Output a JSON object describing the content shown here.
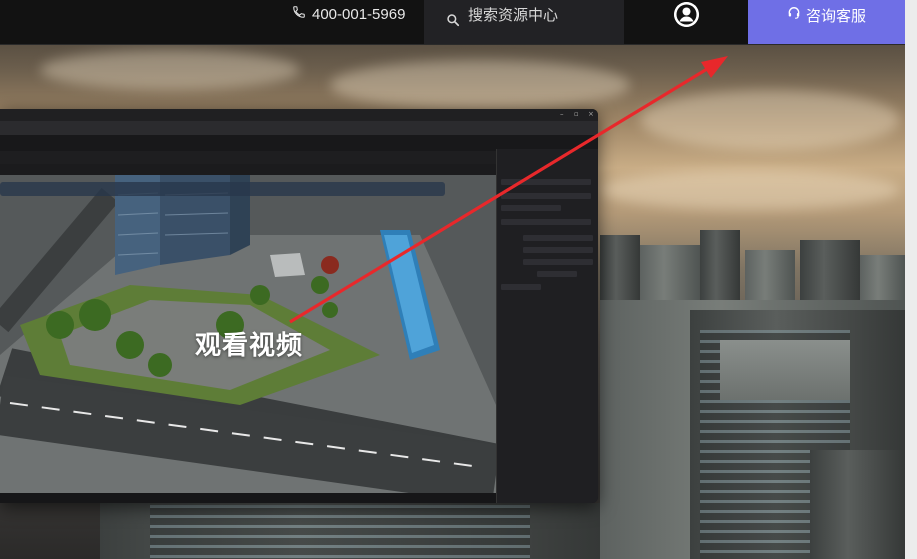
{
  "topbar": {
    "phone_number": "400-001-5969",
    "search_placeholder": "搜索资源中心",
    "customer_service_label": "咨询客服"
  },
  "video": {
    "watch_label": "观看视频"
  },
  "icons": {
    "phone": "phone-icon",
    "search": "search-icon",
    "avatar": "user-avatar-icon",
    "headset": "headset-icon"
  },
  "colors": {
    "topbar_bg": "#121212",
    "search_bg": "#222225",
    "cs_button_bg": "#6f6fe6",
    "arrow": "#e8282b"
  }
}
